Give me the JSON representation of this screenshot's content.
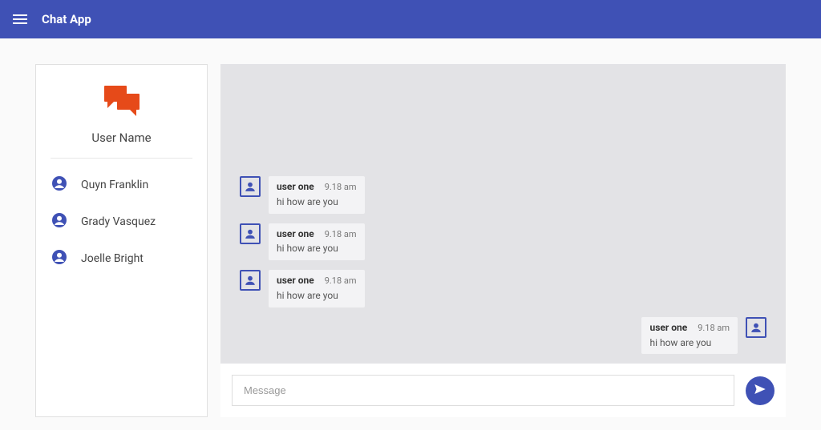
{
  "header": {
    "title": "Chat App"
  },
  "sidebar": {
    "user_name": "User Name",
    "contacts": [
      {
        "name": "Quyn Franklin"
      },
      {
        "name": "Grady Vasquez"
      },
      {
        "name": "Joelle Bright"
      }
    ]
  },
  "chat": {
    "messages": [
      {
        "direction": "in",
        "sender": "user one",
        "time": "9.18 am",
        "text": "hi how are you"
      },
      {
        "direction": "in",
        "sender": "user one",
        "time": "9.18 am",
        "text": "hi how are you"
      },
      {
        "direction": "in",
        "sender": "user one",
        "time": "9.18 am",
        "text": "hi how are you"
      },
      {
        "direction": "out",
        "sender": "user one",
        "time": "9.18 am",
        "text": "hi how are you"
      }
    ]
  },
  "composer": {
    "placeholder": "Message"
  },
  "colors": {
    "primary": "#3f51b5",
    "logo": "#e64a19"
  }
}
